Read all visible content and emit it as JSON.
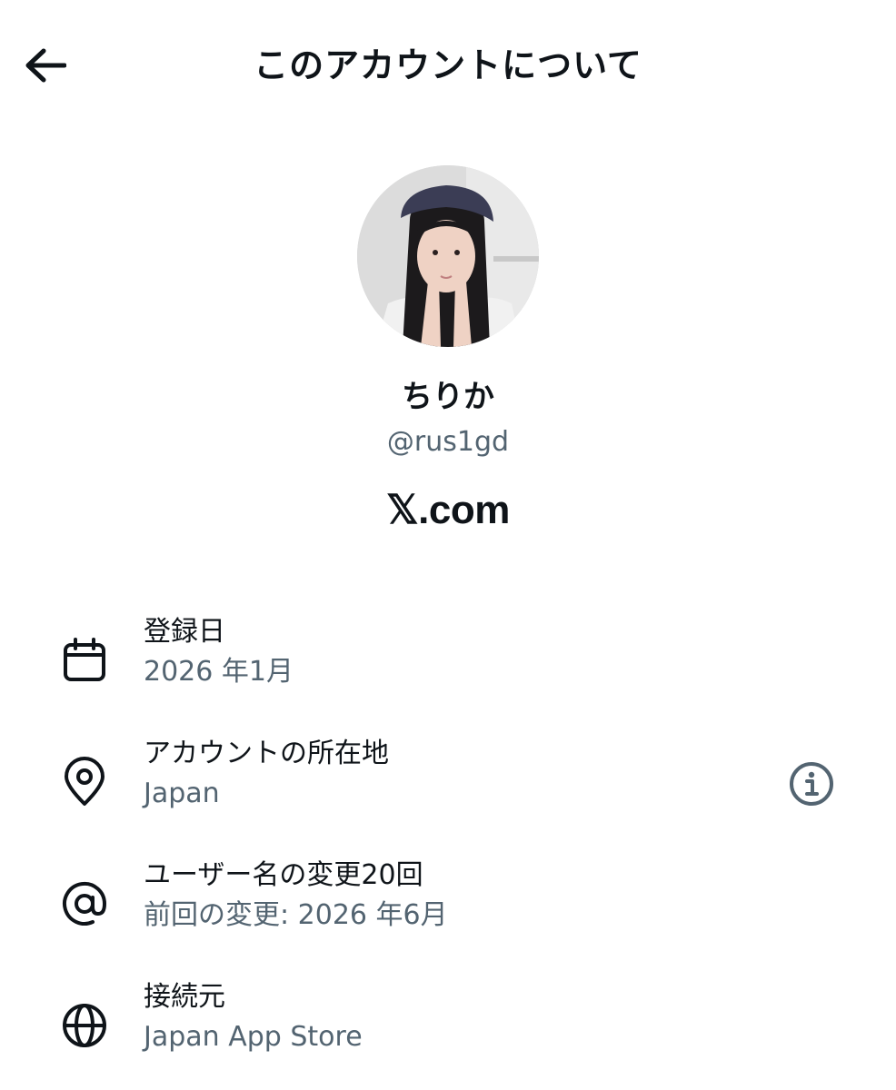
{
  "header": {
    "title": "このアカウントについて",
    "back_icon": "arrow-left-icon"
  },
  "profile": {
    "display_name": "ちりか",
    "handle": "@rus1gd",
    "brand_x": "𝕏",
    "brand_rest": ".com"
  },
  "details": [
    {
      "icon": "calendar-icon",
      "label": "登録日",
      "value": "2026 年1月"
    },
    {
      "icon": "location-pin-icon",
      "label": "アカウントの所在地",
      "value": "Japan",
      "action_icon": "info-icon"
    },
    {
      "icon": "at-sign-icon",
      "label": "ユーザー名の変更20回",
      "value": "前回の変更: 2026 年6月"
    },
    {
      "icon": "globe-icon",
      "label": "接続元",
      "value": "Japan App Store"
    }
  ],
  "colors": {
    "text_primary": "#0f1419",
    "text_secondary": "#536471",
    "background": "#ffffff"
  }
}
